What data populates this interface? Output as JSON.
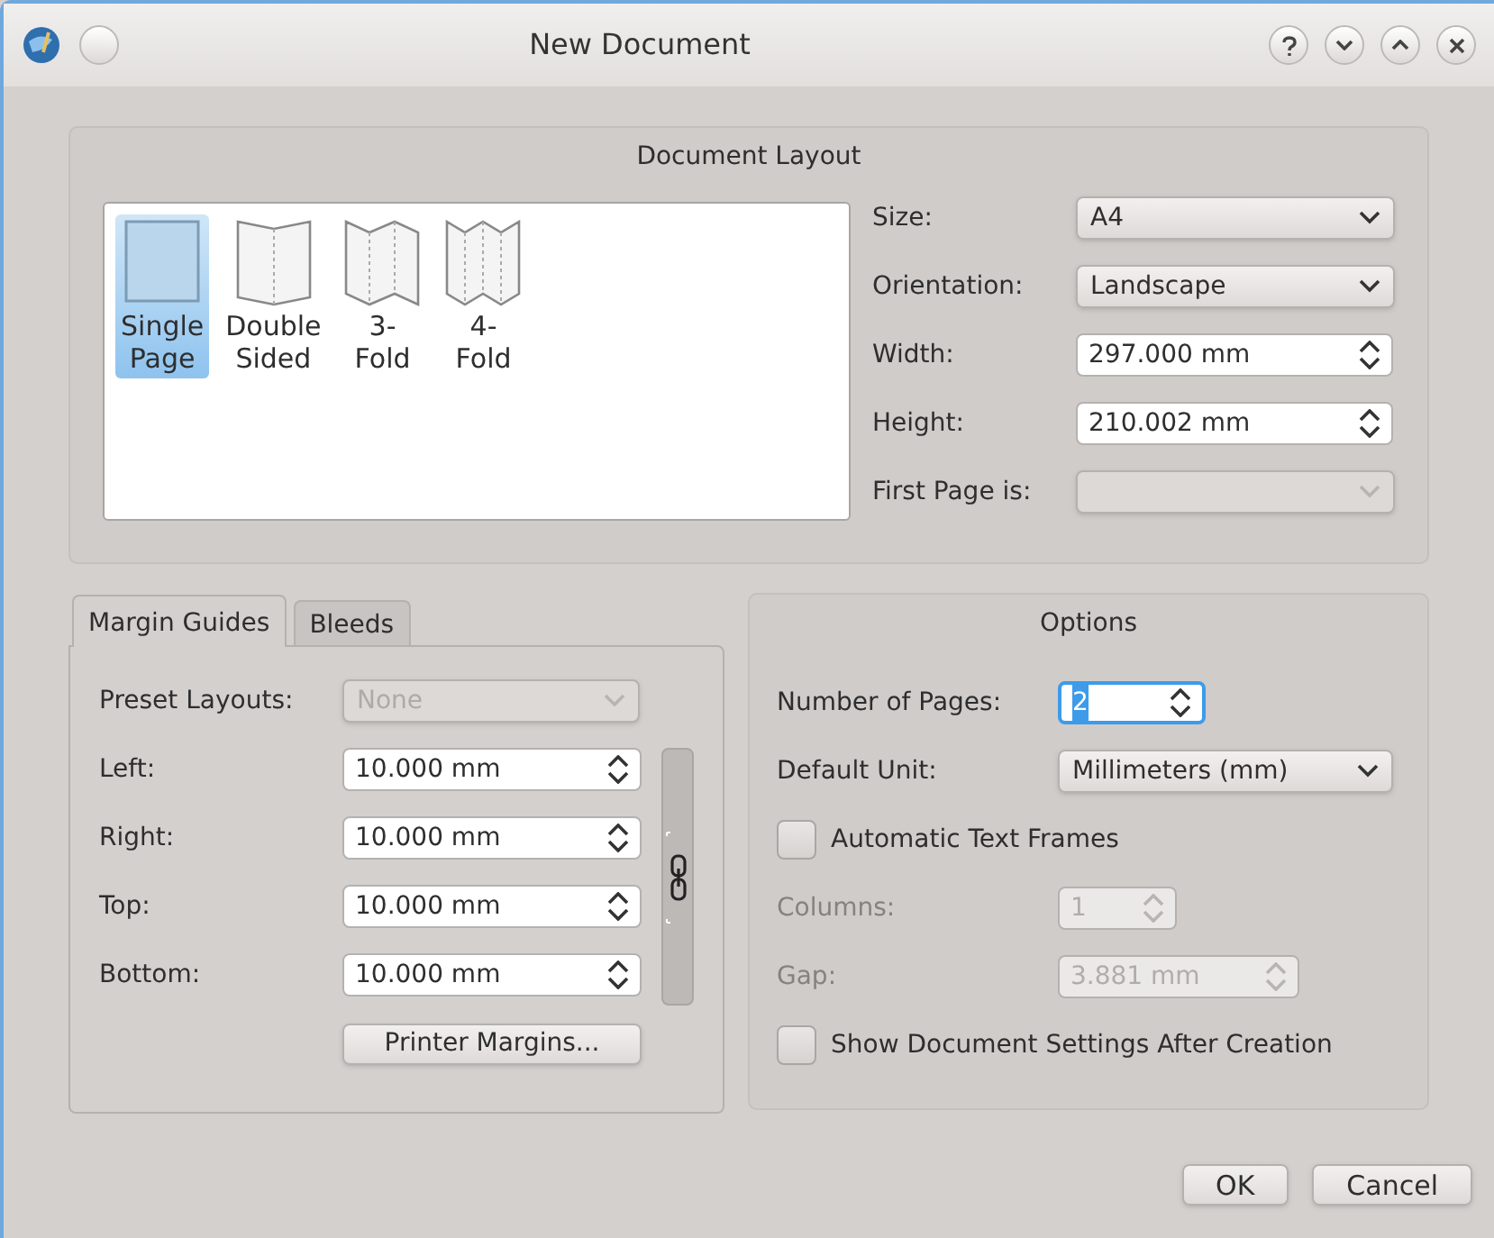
{
  "window": {
    "title": "New Document"
  },
  "document_layout": {
    "title": "Document Layout",
    "layouts": [
      {
        "kind": "single",
        "label": "Single Page",
        "selected": true
      },
      {
        "kind": "double",
        "label": "Double Sided",
        "selected": false
      },
      {
        "kind": "three",
        "label": "3-Fold",
        "selected": false
      },
      {
        "kind": "four",
        "label": "4-Fold",
        "selected": false
      }
    ],
    "fields": [
      {
        "kind": "dropdown",
        "label": "Size:",
        "value": "A4",
        "disabled": false
      },
      {
        "kind": "dropdown",
        "label": "Orientation:",
        "value": "Landscape",
        "disabled": false
      },
      {
        "kind": "spin",
        "label": "Width:",
        "value": "297.000 mm",
        "disabled": false
      },
      {
        "kind": "spin",
        "label": "Height:",
        "value": "210.002 mm",
        "disabled": false
      },
      {
        "kind": "dropdown",
        "label": "First Page is:",
        "disabled": true
      }
    ]
  },
  "tabs": [
    {
      "label": "Margin Guides",
      "selected": true
    },
    {
      "label": "Bleeds",
      "selected": false
    }
  ],
  "margin_guides": {
    "preset": {
      "label": "Preset Layouts:",
      "value": "None",
      "disabled": true
    },
    "fields": [
      {
        "label": "Left:",
        "value": "10.000 mm"
      },
      {
        "label": "Right:",
        "value": "10.000 mm"
      },
      {
        "label": "Top:",
        "value": "10.000 mm"
      },
      {
        "label": "Bottom:",
        "value": "10.000 mm"
      }
    ],
    "printer_margins": "Printer Margins..."
  },
  "options": {
    "title": "Options",
    "rows": [
      {
        "kind": "spin",
        "label": "Number of Pages:",
        "value": "2",
        "disabled": false,
        "focused": true
      },
      {
        "kind": "dropdown",
        "label": "Default Unit:",
        "value": "Millimeters (mm)",
        "disabled": false
      },
      {
        "kind": "checkbox",
        "label": "Automatic Text Frames",
        "checked": false
      },
      {
        "kind": "spin",
        "label": "Columns:",
        "value": "1",
        "disabled": true,
        "focused": false
      },
      {
        "kind": "spin",
        "label": "Gap:",
        "value": "3.881 mm",
        "disabled": true,
        "focused": false
      },
      {
        "kind": "checkbox",
        "label": "Show Document Settings After Creation",
        "checked": false
      }
    ]
  },
  "buttons": [
    "OK",
    "Cancel"
  ]
}
